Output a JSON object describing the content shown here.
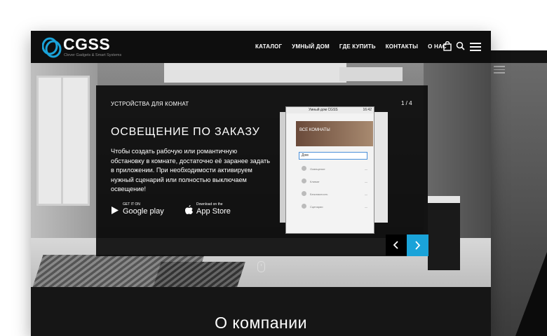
{
  "header": {
    "brand": "CGSS",
    "tagline": "Clever Gadgets & Smart Systems",
    "nav": [
      "КАТАЛОГ",
      "УМНЫЙ ДОМ",
      "ГДЕ КУПИТЬ",
      "КОНТАКТЫ",
      "О НАС"
    ],
    "icons": [
      "bag-icon",
      "search-icon",
      "menu-icon"
    ]
  },
  "slider": {
    "kicker": "УСТРОЙСТВА ДЛЯ КОМНАТ",
    "counter": "1 / 4",
    "title": "ОСВЕЩЕНИЕ ПО ЗАКАЗУ",
    "description": "Чтобы создать рабочую или романтичную обстановку в комнате, достаточно её заранее задать в приложении. При необходимости активируем нужный сценарий или полностью выключаем освещение!",
    "google_small": "GET IT ON",
    "google_big": "Google play",
    "apple_small": "Download on the",
    "apple_big": "App Store",
    "phone": {
      "status_time": "16:42",
      "app_title": "Умный дом CGSS",
      "banner_text": "ВСЕ КОМНАТЫ",
      "room_select": "Дом",
      "rows": [
        {
          "label": "Освещение",
          "value": "—"
        },
        {
          "label": "Климат",
          "value": "—"
        },
        {
          "label": "Безопасность",
          "value": "—"
        },
        {
          "label": "Сценарии",
          "value": "—"
        }
      ]
    }
  },
  "about": {
    "title": "О компании"
  },
  "colors": {
    "accent": "#1aa3d9",
    "nav_bg": "#0e0e0e",
    "card_bg": "#0c0c0c"
  }
}
